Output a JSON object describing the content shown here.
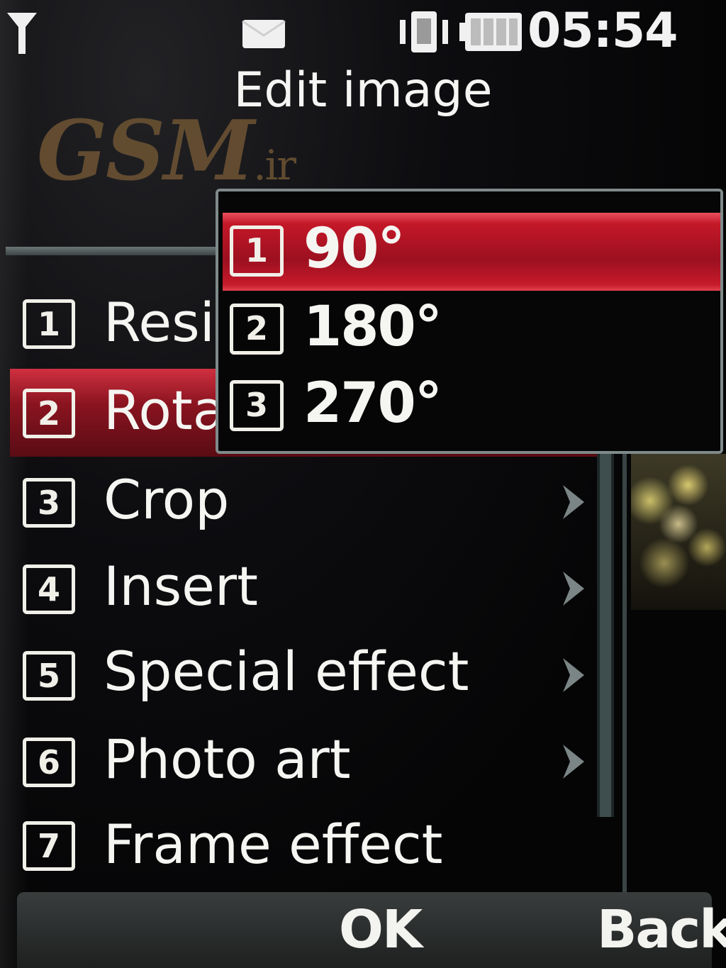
{
  "status_bar": {
    "time": "05:54",
    "icons": [
      "signal-icon",
      "message-icon",
      "vibrate-icon",
      "battery-icon"
    ]
  },
  "title": "Edit image",
  "watermark": {
    "main": "GSM",
    "suffix": ".ir"
  },
  "menu": {
    "items": [
      {
        "number": "1",
        "label": "Resi",
        "has_submenu": false
      },
      {
        "number": "2",
        "label": "Rota",
        "has_submenu": false,
        "selected": true
      },
      {
        "number": "3",
        "label": "Crop",
        "has_submenu": true
      },
      {
        "number": "4",
        "label": "Insert",
        "has_submenu": true
      },
      {
        "number": "5",
        "label": "Special effect",
        "has_submenu": true
      },
      {
        "number": "6",
        "label": "Photo art",
        "has_submenu": true
      },
      {
        "number": "7",
        "label": "Frame effect",
        "has_submenu": false
      }
    ]
  },
  "popup": {
    "items": [
      {
        "number": "1",
        "label": "90°",
        "selected": true
      },
      {
        "number": "2",
        "label": "180°"
      },
      {
        "number": "3",
        "label": "270°"
      }
    ]
  },
  "softkeys": {
    "center": "OK",
    "right": "Back"
  },
  "colors": {
    "highlight": "#b01626",
    "background": "#050506",
    "text": "#f5f5f2",
    "border": "#7f8a8a"
  }
}
